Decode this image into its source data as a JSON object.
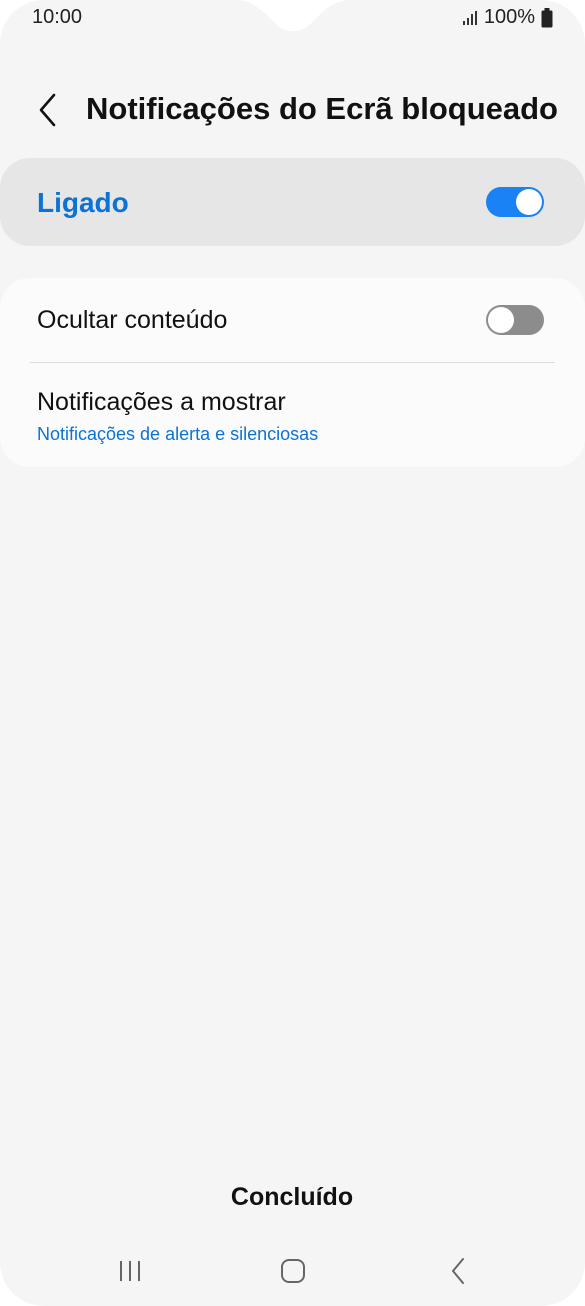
{
  "status_bar": {
    "time": "10:00",
    "battery_percent": "100%",
    "icons": [
      "signal-icon",
      "battery-icon"
    ]
  },
  "header": {
    "title": "Notificações do Ecrã bloqueado",
    "back_icon": "chevron-left-icon"
  },
  "master_switch": {
    "label": "Ligado",
    "enabled": true
  },
  "settings": {
    "hide_content": {
      "label": "Ocultar conteúdo",
      "enabled": false
    },
    "notifications_to_show": {
      "label": "Notificações a mostrar",
      "value": "Notificações de alerta e silenciosas"
    }
  },
  "footer": {
    "done_label": "Concluído"
  },
  "navigation_bar": {
    "buttons": [
      "recent-apps-icon",
      "home-icon",
      "back-icon"
    ]
  },
  "colors": {
    "accent": "#0b72d6",
    "toggle_on": "#1a82f5",
    "toggle_off": "#8c8c8c",
    "background": "#f5f5f5"
  }
}
